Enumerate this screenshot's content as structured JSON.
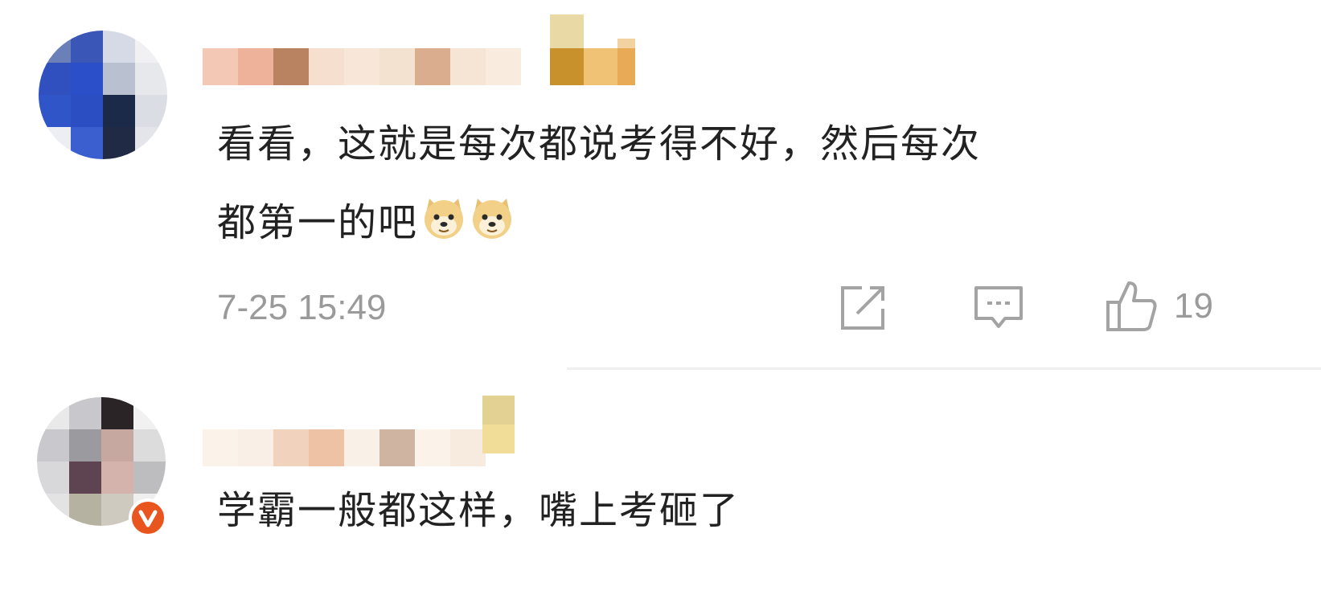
{
  "comments": [
    {
      "text_line1": "看看，这就是每次都说考得不好，然后每次",
      "text_line2": "都第一的吧",
      "emojis": [
        "doge-emoji",
        "doge-emoji"
      ],
      "timestamp": "7-25 15:49",
      "actions": {
        "share_icon": "share-icon",
        "reply_icon": "comment-icon",
        "like_icon": "thumbs-up-icon",
        "like_count": "19"
      }
    },
    {
      "text_line1": "学霸一般都这样，嘴上考砸了",
      "verified_badge": "verified-v-icon"
    }
  ],
  "colors": {
    "text": "#222222",
    "meta": "#9a9a9a",
    "badge": "#e8551f",
    "divider": "#efefef"
  }
}
